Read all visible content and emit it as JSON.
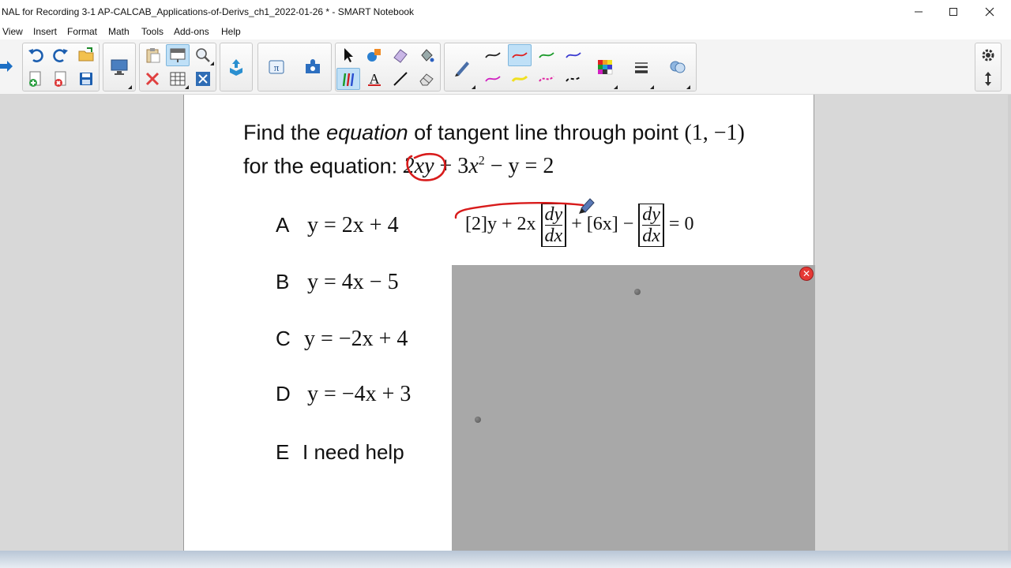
{
  "window": {
    "title": "NAL for Recording 3-1 AP-CALCAB_Applications-of-Derivs_ch1_2022-01-26 * - SMART Notebook",
    "controls": [
      "minimize-icon",
      "maximize-icon",
      "close-icon"
    ]
  },
  "menu": {
    "items": [
      "View",
      "Insert",
      "Format",
      "Math",
      "Tools",
      "Add-ons",
      "Help"
    ]
  },
  "toolbar": {
    "icons": [
      "forward-arrow-icon",
      "undo-icon",
      "redo-icon",
      "open-folder-icon",
      "add-page-icon",
      "delete-page-icon",
      "save-icon",
      "display-icon",
      "paste-icon",
      "screen-shade-icon",
      "zoom-icon",
      "delete-icon",
      "table-icon",
      "full-screen-icon",
      "upload-icon",
      "math-tools-icon",
      "add-ons-icon",
      "select-icon",
      "shapes-icon",
      "eraser-icon",
      "fill-icon",
      "magic-pen-icon",
      "text-icon",
      "line-icon",
      "eraser-2-icon",
      "pen-icon",
      "line-style-black-icon",
      "line-style-red-icon",
      "line-style-green-icon",
      "line-style-purple-icon",
      "line-style-magenta-icon",
      "line-style-yellow-icon",
      "line-style-pink-icon",
      "line-style-dashed-icon",
      "color-palette-icon",
      "properties-icon",
      "gallery-icon",
      "settings-icon",
      "move-toolbar-icon"
    ],
    "colors": {
      "black": "#222222",
      "red": "#e02020",
      "green": "#1a9a2a",
      "purple": "#3b3bd0",
      "magenta": "#d020c0",
      "yellow": "#f0e020",
      "pink": "#e020a0"
    }
  },
  "question": {
    "line1_prefix": "Find the ",
    "line1_emph": "equation",
    "line1_suffix": " of tangent line through point ",
    "point": "(1, −1)",
    "line2_prefix": "for the equation: ",
    "equation": {
      "term1": "2xy",
      "plus": " + 3",
      "x": "x",
      "exp": "2",
      "rest": " − y = 2"
    }
  },
  "choices": [
    {
      "letter": "A",
      "expr": "y = 2x + 4"
    },
    {
      "letter": "B",
      "expr": "y = 4x − 5"
    },
    {
      "letter": "C",
      "expr": "y = −2x + 4"
    },
    {
      "letter": "D",
      "expr": "y = −4x + 3"
    },
    {
      "letter": "E",
      "text": "I need help"
    }
  ],
  "work": {
    "part1": "[2]y + 2x",
    "frac_num": "dy",
    "frac_den": "dx",
    "part2": " + [6x] − ",
    "frac2_num": "dy",
    "frac2_den": "dx",
    "part3": " = 0"
  },
  "ink_color": "#d81b1b",
  "close_symbol": "✕"
}
